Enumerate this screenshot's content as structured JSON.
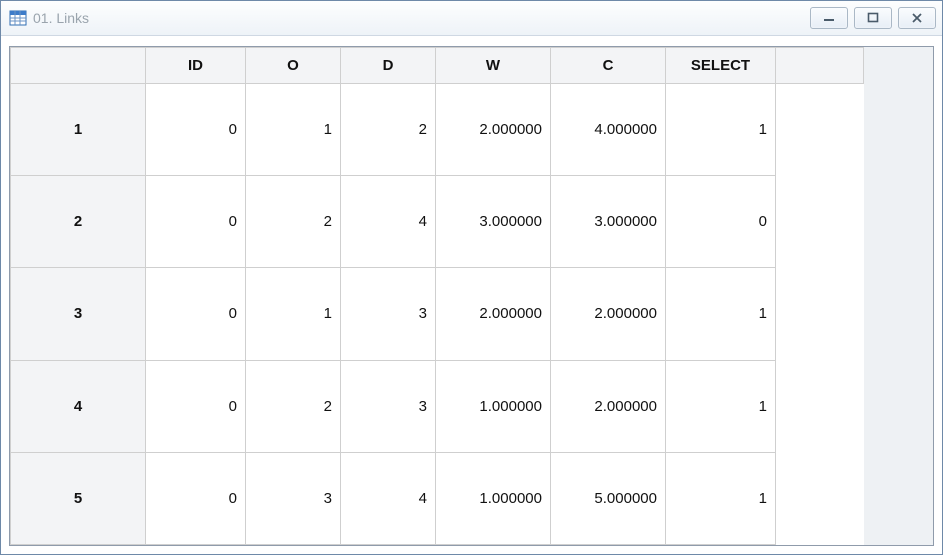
{
  "window": {
    "title": "01. Links"
  },
  "table": {
    "columns": [
      "ID",
      "O",
      "D",
      "W",
      "C",
      "SELECT"
    ],
    "rows": [
      {
        "n": "1",
        "ID": "0",
        "O": "1",
        "D": "2",
        "W": "2.000000",
        "C": "4.000000",
        "SELECT": "1"
      },
      {
        "n": "2",
        "ID": "0",
        "O": "2",
        "D": "4",
        "W": "3.000000",
        "C": "3.000000",
        "SELECT": "0"
      },
      {
        "n": "3",
        "ID": "0",
        "O": "1",
        "D": "3",
        "W": "2.000000",
        "C": "2.000000",
        "SELECT": "1"
      },
      {
        "n": "4",
        "ID": "0",
        "O": "2",
        "D": "3",
        "W": "1.000000",
        "C": "2.000000",
        "SELECT": "1"
      },
      {
        "n": "5",
        "ID": "0",
        "O": "3",
        "D": "4",
        "W": "1.000000",
        "C": "5.000000",
        "SELECT": "1"
      }
    ]
  }
}
